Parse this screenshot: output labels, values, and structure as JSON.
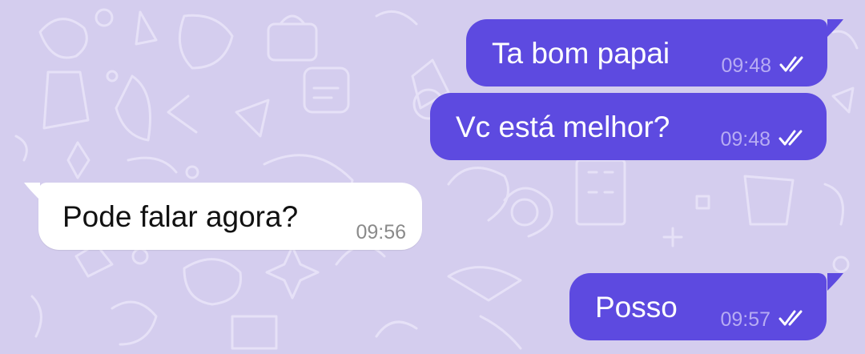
{
  "theme": {
    "background": "#d4cdee",
    "outgoing_bubble": "#5d4ae0",
    "incoming_bubble": "#ffffff",
    "doodle_stroke": "#e6e1f7"
  },
  "messages": [
    {
      "direction": "outgoing",
      "text": "Ta bom papai",
      "time": "09:48",
      "status_icon": "double-check-icon"
    },
    {
      "direction": "outgoing",
      "text": "Vc está melhor?",
      "time": "09:48",
      "status_icon": "double-check-icon"
    },
    {
      "direction": "incoming",
      "text": "Pode falar agora?",
      "time": "09:56"
    },
    {
      "direction": "outgoing",
      "text": "Posso",
      "time": "09:57",
      "status_icon": "double-check-icon"
    }
  ]
}
